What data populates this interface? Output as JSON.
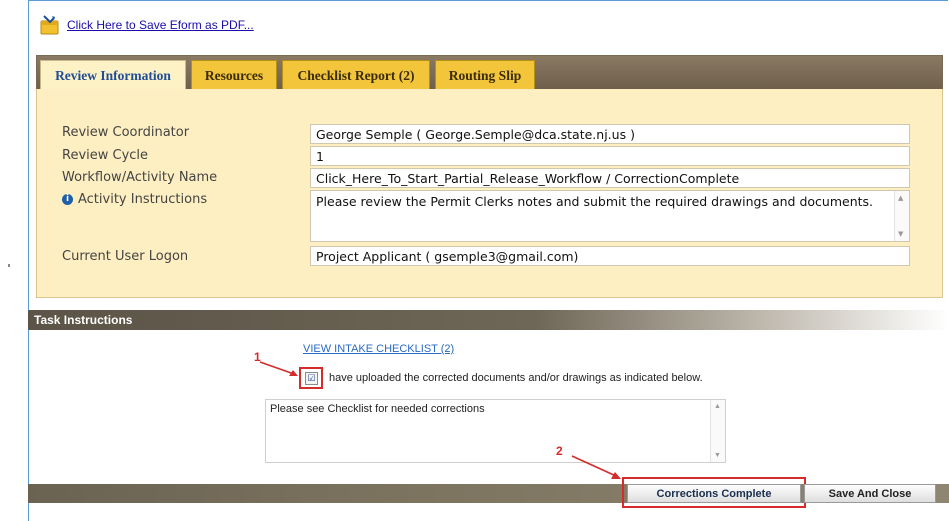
{
  "toolbar": {
    "pdf_link": "Click Here to Save Eform as PDF...",
    "pdf_icon": "pdf-export-icon"
  },
  "tabs": [
    {
      "label": "Review Information",
      "active": true
    },
    {
      "label": "Resources",
      "active": false
    },
    {
      "label": "Checklist Report (2)",
      "active": false
    },
    {
      "label": "Routing Slip",
      "active": false
    }
  ],
  "review": {
    "coordinator_label": "Review Coordinator",
    "coordinator_value": "George Semple  ( George.Semple@dca.state.nj.us )",
    "cycle_label": "Review Cycle",
    "cycle_value": "1",
    "workflow_label": "Workflow/Activity Name",
    "workflow_value": "Click_Here_To_Start_Partial_Release_Workflow / CorrectionComplete",
    "instructions_label": "Activity Instructions",
    "instructions_value": "Please review the Permit Clerks notes and submit the required drawings and documents.",
    "logon_label": "Current User Logon",
    "logon_value": "Project Applicant ( gsemple3@gmail.com)"
  },
  "task": {
    "header": "Task Instructions",
    "view_link": "VIEW INTAKE CHECKLIST (2)",
    "checkbox_checked": true,
    "checkbox_label": "have uploaded the corrected documents and/or drawings as indicated below.",
    "notes_value": "Please see Checklist for needed corrections"
  },
  "annotations": {
    "marker1": "1",
    "marker2": "2",
    "color": "#d62b2b"
  },
  "buttons": {
    "corrections_complete": "Corrections Complete",
    "save_close": "Save And Close"
  }
}
